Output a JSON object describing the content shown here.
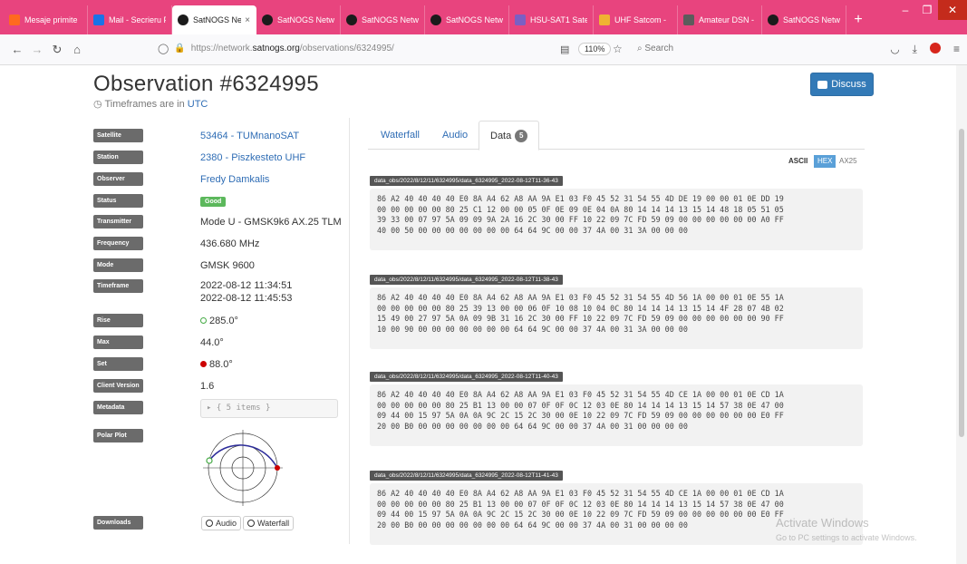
{
  "browser": {
    "tabs": [
      {
        "label": "Mesaje primite",
        "icon": "fire"
      },
      {
        "label": "Mail - Secrieru F",
        "icon": "mail"
      },
      {
        "label": "SatNOGS Netw",
        "icon": "sat",
        "active": true
      },
      {
        "label": "SatNOGS Netwo",
        "icon": "sat"
      },
      {
        "label": "SatNOGS Netwo",
        "icon": "sat"
      },
      {
        "label": "SatNOGS Netwo",
        "icon": "sat"
      },
      {
        "label": "HSU-SAT1 Satel",
        "icon": "hsu"
      },
      {
        "label": "UHF Satcom -",
        "icon": "uhf"
      },
      {
        "label": "Amateur DSN -",
        "icon": "dsn"
      },
      {
        "label": "SatNOGS Netwo",
        "icon": "sat"
      }
    ],
    "url_prefix": "https://network.",
    "url_domain": "satnogs.org",
    "url_path": "/observations/6324995/",
    "zoom": "110%",
    "search_placeholder": "Search"
  },
  "page": {
    "title": "Observation #6324995",
    "timeframe_note": "Timeframes are in",
    "timeframe_tz": "UTC",
    "discuss_label": "Discuss"
  },
  "info": {
    "satellite_label": "Satellite",
    "satellite": "53464 - TUMnanoSAT",
    "station_label": "Station",
    "station": "2380 - Piszkesteto UHF",
    "observer_label": "Observer",
    "observer": "Fredy Damkalis",
    "status_label": "Status",
    "status": "Good",
    "transmitter_label": "Transmitter",
    "transmitter": "Mode U - GMSK9k6 AX.25 TLM",
    "frequency_label": "Frequency",
    "frequency": "436.680 MHz",
    "mode_label": "Mode",
    "mode": "GMSK 9600",
    "timeframe_label": "Timeframe",
    "timeframe_start": "2022-08-12   11:34:51",
    "timeframe_end": "2022-08-12   11:45:53",
    "rise_label": "Rise",
    "rise": "285.0°",
    "max_label": "Max",
    "max": "44.0°",
    "set_label": "Set",
    "set": "88.0°",
    "client_version_label": "Client Version",
    "client_version": "1.6",
    "metadata_label": "Metadata",
    "metadata": "▸ {  5 items  }",
    "polar_label": "Polar Plot",
    "downloads_label": "Downloads",
    "download_audio": "Audio",
    "download_waterfall": "Waterfall"
  },
  "tabs": {
    "waterfall": "Waterfall",
    "audio": "Audio",
    "data": "Data",
    "data_count": "5"
  },
  "formats": {
    "ascii": "ASCII",
    "hex": "HEX",
    "ax25": "AX25"
  },
  "packets": [
    {
      "filename": "data_obs/2022/8/12/11/6324995/data_6324995_2022-08-12T11-36-43",
      "hex": "86 A2 40 40 40 40 E0 8A A4 62 A8 AA 9A E1 03 F0 45 52 31 54 55 4D DE 19 00 00 01 0E DD 19\n00 00 00 00 00 80 25 C1 12 00 00 05 0F 0E 09 0E 04 0A 80 14 14 14 13 15 14 48 18 05 51 05\n39 33 00 07 97 5A 09 09 9A 2A 16 2C 30 00 FF 10 22 09 7C FD 59 09 00 00 00 00 00 00 A0 FF\n40 00 50 00 00 00 00 00 00 00 64 64 9C 00 00 37 4A 00 31 3A 00 00 00"
    },
    {
      "filename": "data_obs/2022/8/12/11/6324995/data_6324995_2022-08-12T11-38-43",
      "hex": "86 A2 40 40 40 40 E0 8A A4 62 A8 AA 9A E1 03 F0 45 52 31 54 55 4D 56 1A 00 00 01 0E 55 1A\n00 00 00 00 00 80 25 39 13 00 00 06 0F 10 08 10 04 0C 80 14 14 14 13 15 14 4F 28 07 4B 02\n15 49 00 27 97 5A 0A 09 9B 31 16 2C 30 00 FF 10 22 09 7C FD 59 09 00 00 00 00 00 00 90 FF\n10 00 90 00 00 00 00 00 00 00 64 64 9C 00 00 37 4A 00 31 3A 00 00 00"
    },
    {
      "filename": "data_obs/2022/8/12/11/6324995/data_6324995_2022-08-12T11-40-43",
      "hex": "86 A2 40 40 40 40 E0 8A A4 62 A8 AA 9A E1 03 F0 45 52 31 54 55 4D CE 1A 00 00 01 0E CD 1A\n00 00 00 00 00 80 25 B1 13 00 00 07 0F 0F 0C 12 03 0E 80 14 14 14 13 15 14 57 38 0E 47 00\n09 44 00 15 97 5A 0A 0A 9C 2C 15 2C 30 00 0E 10 22 09 7C FD 59 09 00 00 00 00 00 00 E0 FF\n20 00 B0 00 00 00 00 00 00 00 64 64 9C 00 00 37 4A 00 31 00 00 00 00"
    },
    {
      "filename": "data_obs/2022/8/12/11/6324995/data_6324995_2022-08-12T11-41-43",
      "hex": "86 A2 40 40 40 40 E0 8A A4 62 A8 AA 9A E1 03 F0 45 52 31 54 55 4D CE 1A 00 00 01 0E CD 1A\n00 00 00 00 00 80 25 B1 13 00 00 07 0F 0F 0C 12 03 0E 80 14 14 14 13 15 14 57 38 0E 47 00\n09 44 00 15 97 5A 0A 0A 9C 2C 15 2C 30 00 0E 10 22 09 7C FD 59 09 00 00 00 00 00 00 E0 FF\n20 00 B0 00 00 00 00 00 00 00 64 64 9C 00 00 37 4A 00 31 00 00 00 00"
    }
  ],
  "watermark": {
    "line1": "Activate Windows",
    "line2": "Go to PC settings to activate Windows."
  }
}
